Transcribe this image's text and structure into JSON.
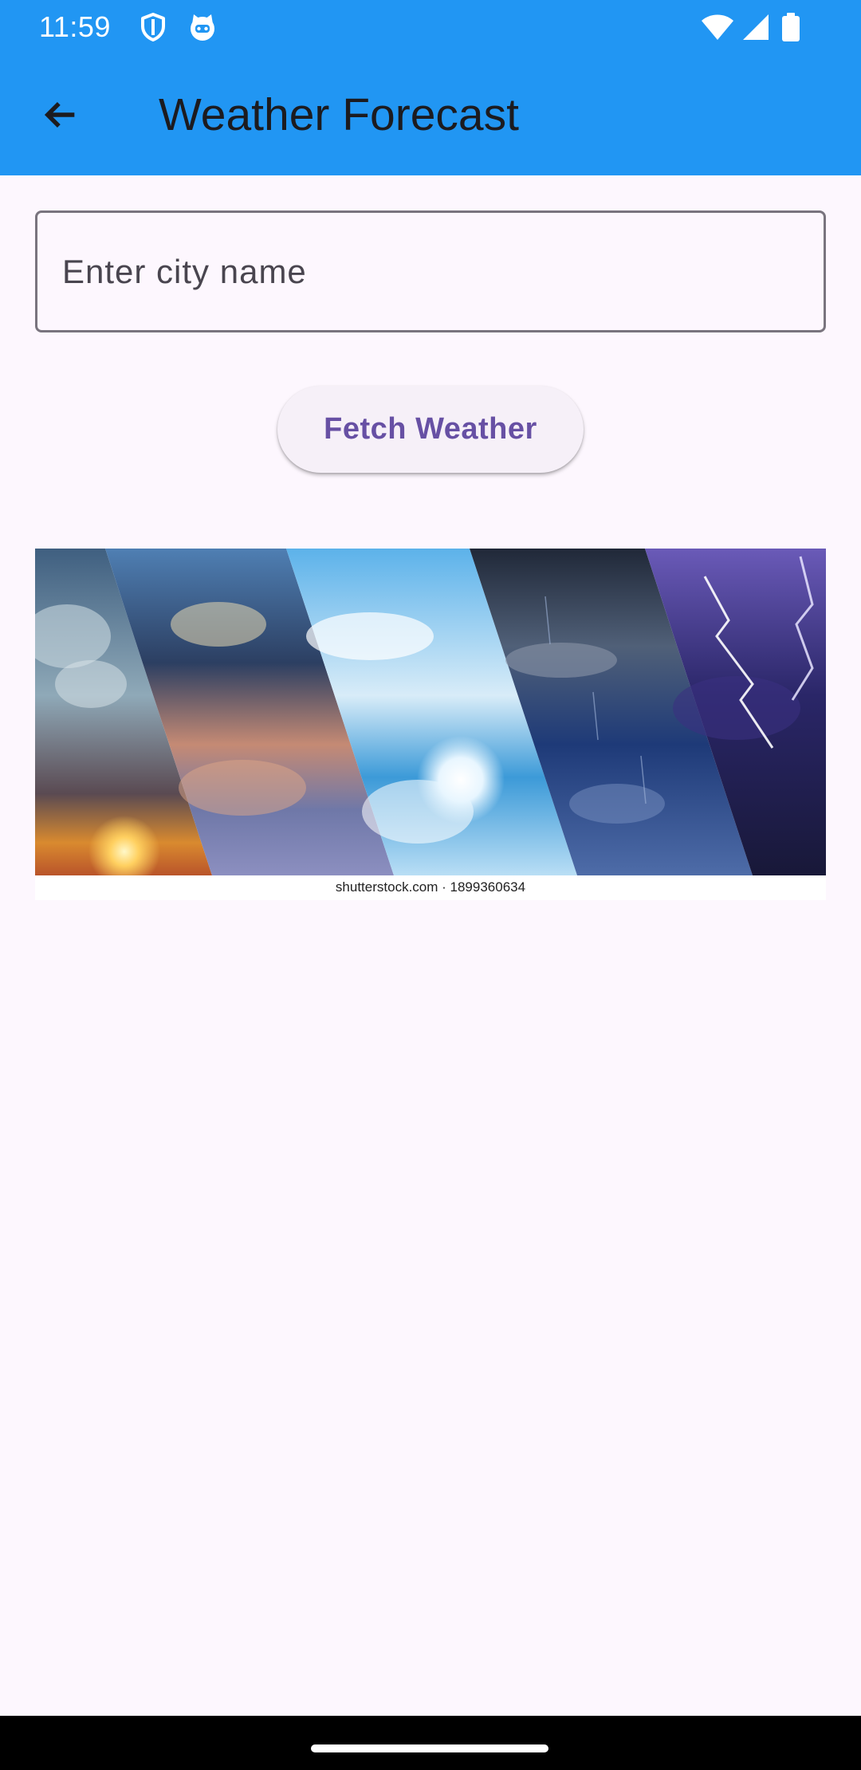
{
  "status_bar": {
    "time": "11:59",
    "background_color": "#2196F3",
    "left_icons": [
      "shield-icon",
      "cat-face-icon"
    ],
    "right_icons": [
      "wifi-icon",
      "cell-signal-icon",
      "battery-icon"
    ]
  },
  "app_bar": {
    "title": "Weather Forecast",
    "background_color": "#2196F3",
    "back_icon": "arrow-back-icon"
  },
  "city_input": {
    "placeholder": "Enter city name",
    "value": ""
  },
  "fetch_button": {
    "label": "Fetch Weather",
    "text_color": "#6750A4"
  },
  "weather_image": {
    "watermark": "shutterstock.com · 1899360634"
  },
  "page": {
    "background_color": "#FDF7FE"
  }
}
